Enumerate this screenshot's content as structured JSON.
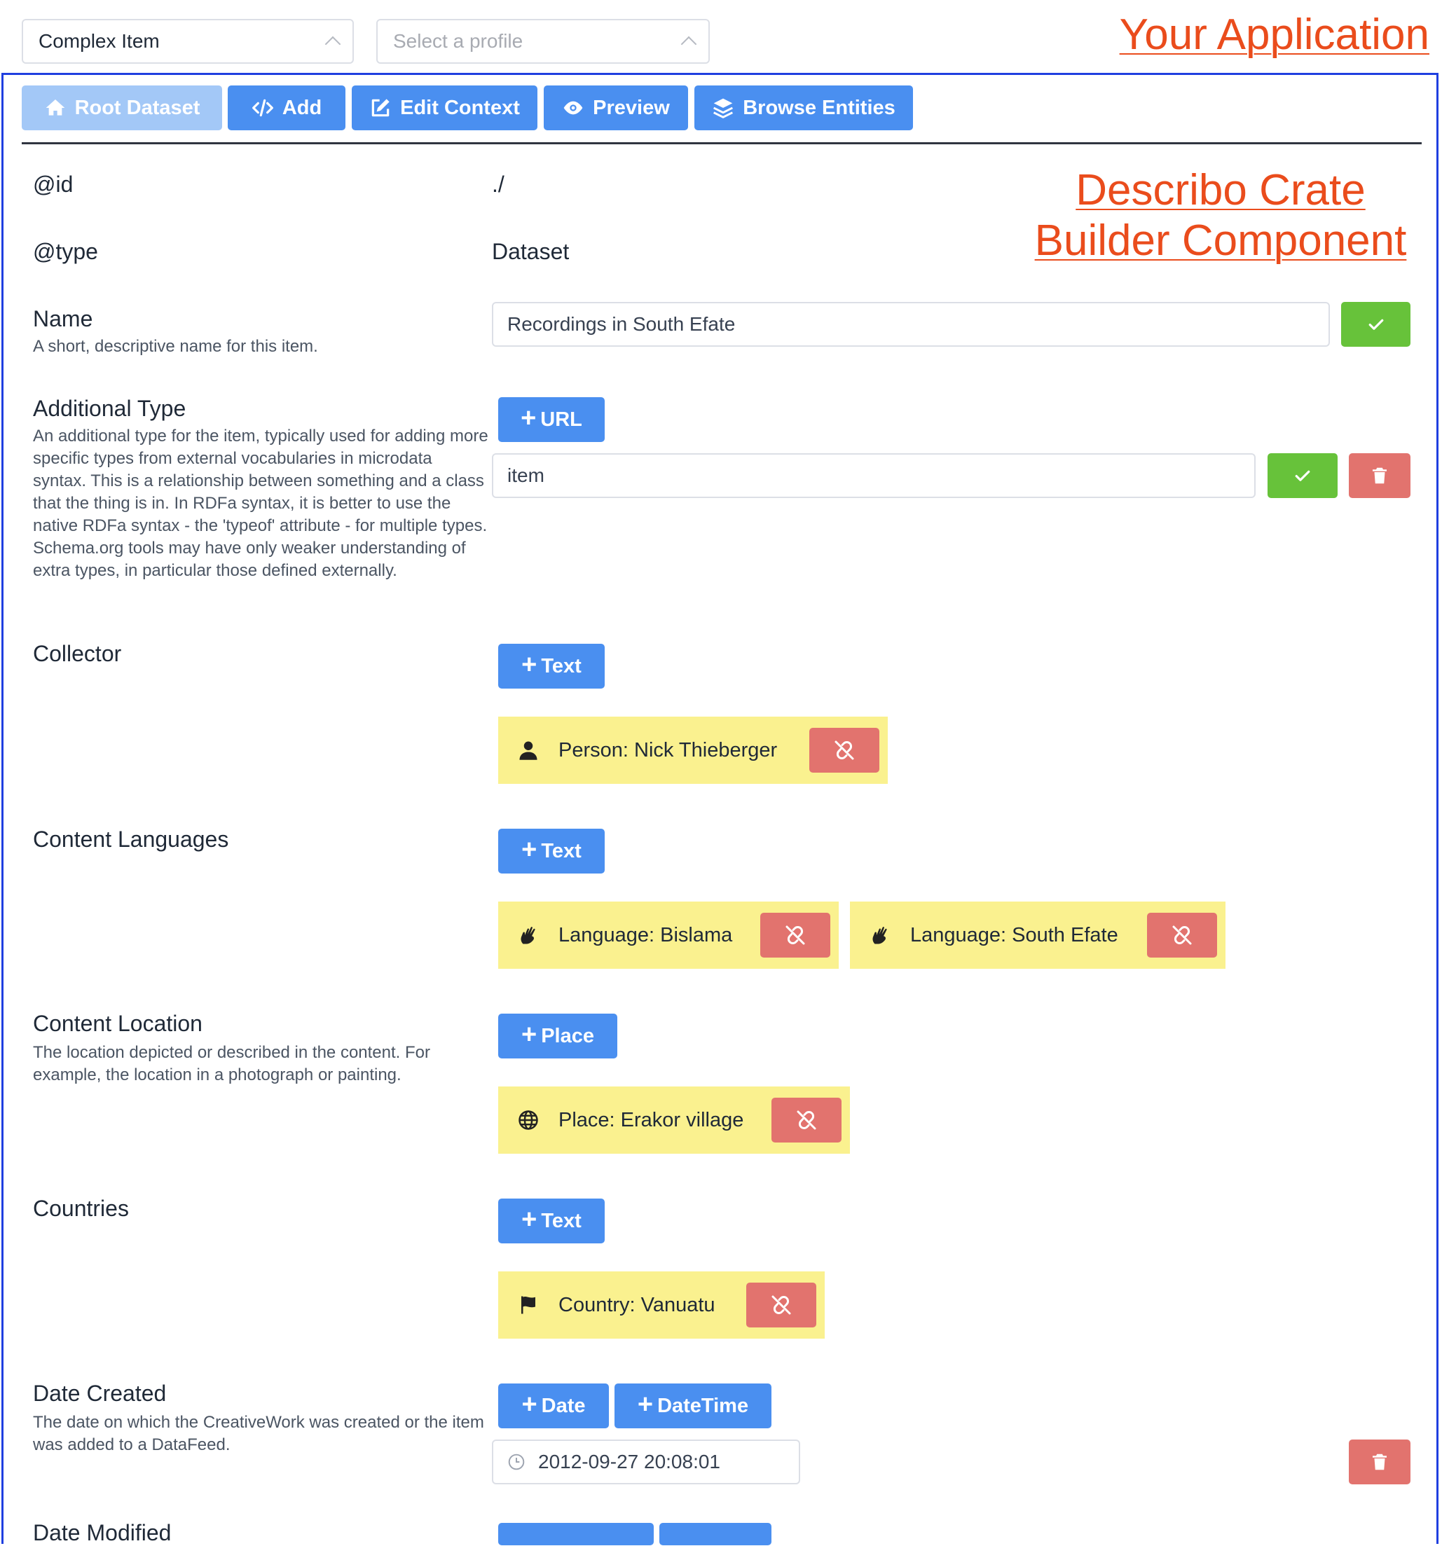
{
  "top": {
    "item_select": {
      "value": "Complex Item"
    },
    "profile_select": {
      "placeholder": "Select a profile"
    },
    "your_application": "Your Application",
    "describo_title": "Describo Crate Builder Component"
  },
  "nav": {
    "root_dataset": "Root Dataset",
    "add": "Add",
    "edit_context": "Edit Context",
    "preview": "Preview",
    "browse_entities": "Browse Entities"
  },
  "id_row": {
    "label": "@id",
    "value": "./"
  },
  "type_row": {
    "label": "@type",
    "value": "Dataset"
  },
  "name_row": {
    "label": "Name",
    "help": "A short, descriptive name for this item.",
    "value": "Recordings in South Efate"
  },
  "additional_type_row": {
    "label": "Additional Type",
    "help": "An additional type for the item, typically used for adding more specific types from external vocabularies in microdata syntax. This is a relationship between something and a class that the thing is in. In RDFa syntax, it is better to use the native RDFa syntax - the 'typeof' attribute - for multiple types. Schema.org tools may have only weaker understanding of extra types, in particular those defined externally.",
    "add_label": "URL",
    "value": "item"
  },
  "collector_row": {
    "label": "Collector",
    "add_label": "Text",
    "entities": [
      {
        "label": "Person: Nick Thieberger",
        "icon": "user-icon"
      }
    ]
  },
  "content_languages_row": {
    "label": "Content Languages",
    "add_label": "Text",
    "entities": [
      {
        "label": "Language: Bislama",
        "icon": "sign-language-icon"
      },
      {
        "label": "Language: South Efate",
        "icon": "sign-language-icon"
      }
    ]
  },
  "content_location_row": {
    "label": "Content Location",
    "help": "The location depicted or described in the content. For example, the location in a photograph or painting.",
    "add_label": "Place",
    "entities": [
      {
        "label": "Place: Erakor village",
        "icon": "globe-icon"
      }
    ]
  },
  "countries_row": {
    "label": "Countries",
    "add_label": "Text",
    "entities": [
      {
        "label": "Country: Vanuatu",
        "icon": "flag-icon"
      }
    ]
  },
  "date_created_row": {
    "label": "Date Created",
    "help": "The date on which the CreativeWork was created or the item was added to a DataFeed.",
    "add_date_label": "Date",
    "add_datetime_label": "DateTime",
    "value": "2012-09-27 20:08:01"
  },
  "date_modified_row": {
    "label": "Date Modified"
  },
  "colors": {
    "primary": "#4a8ff0",
    "success": "#67c23a",
    "danger": "#e2736e",
    "entity_bg": "#faf18f",
    "annotation": "#ea4c1c",
    "frame": "#1f3fe0"
  }
}
